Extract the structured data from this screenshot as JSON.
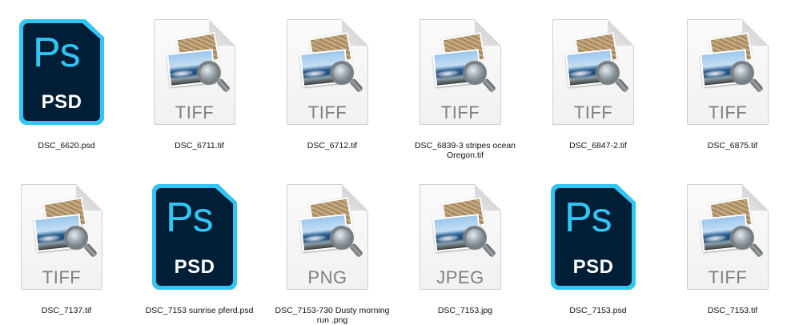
{
  "files": [
    {
      "name": "DSC_6620.psd",
      "kind": "psd",
      "ext_label": "PSD",
      "app_label": "Ps"
    },
    {
      "name": "DSC_6711.tif",
      "kind": "doc",
      "ext_label": "TIFF"
    },
    {
      "name": "DSC_6712.tif",
      "kind": "doc",
      "ext_label": "TIFF"
    },
    {
      "name": "DSC_6839-3 stripes ocean Oregon.tif",
      "kind": "doc",
      "ext_label": "TIFF"
    },
    {
      "name": "DSC_6847-2.tif",
      "kind": "doc",
      "ext_label": "TIFF"
    },
    {
      "name": "DSC_6875.tif",
      "kind": "doc",
      "ext_label": "TIFF"
    },
    {
      "name": "DSC_7137.tif",
      "kind": "doc",
      "ext_label": "TIFF"
    },
    {
      "name": "DSC_7153 sunrise pferd.psd",
      "kind": "psd",
      "ext_label": "PSD",
      "app_label": "Ps"
    },
    {
      "name": "DSC_7153-730 Dusty morning run .png",
      "kind": "doc",
      "ext_label": "PNG"
    },
    {
      "name": "DSC_7153.jpg",
      "kind": "doc",
      "ext_label": "JPEG"
    },
    {
      "name": "DSC_7153.psd",
      "kind": "psd",
      "ext_label": "PSD",
      "app_label": "Ps"
    },
    {
      "name": "DSC_7153.tif",
      "kind": "doc",
      "ext_label": "TIFF"
    }
  ],
  "colors": {
    "psd_frame": "#31c5f4",
    "psd_background": "#001e36",
    "doc_ext_text": "#808080",
    "label_text": "#111111"
  },
  "icons": {
    "psd": "photoshop-psd-file-icon",
    "doc": "image-preview-document-icon"
  }
}
